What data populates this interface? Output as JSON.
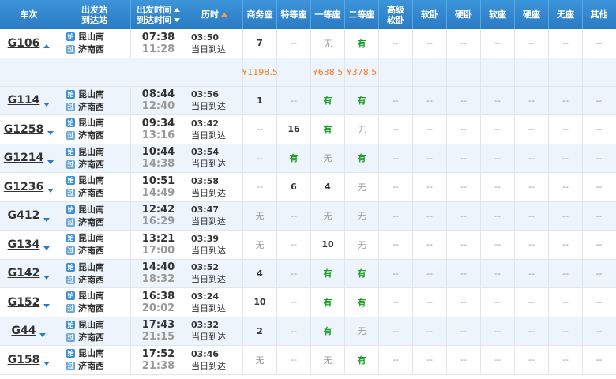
{
  "header": {
    "train": "车次",
    "from_station": "出发站",
    "to_station": "到达站",
    "dep_time": "出发时间",
    "arr_time": "到达时间",
    "duration": "历时",
    "seats": [
      {
        "top": "商务座"
      },
      {
        "top": "特等座"
      },
      {
        "top": "一等座"
      },
      {
        "top": "二等座"
      },
      {
        "top": "高级",
        "bottom": "软卧"
      },
      {
        "top": "软卧"
      },
      {
        "top": "硬卧"
      },
      {
        "top": "软座"
      },
      {
        "top": "硬座"
      },
      {
        "top": "无座"
      },
      {
        "top": "其他"
      }
    ]
  },
  "rows": [
    {
      "train": "G106",
      "expanded": true,
      "from": "昆山南",
      "to": "济南西",
      "dep": "07:38",
      "arr": "11:28",
      "dur": "03:50",
      "note": "当日到达",
      "seats": [
        "7",
        "--",
        "无",
        "有",
        "--",
        "--",
        "--",
        "--",
        "--",
        "--",
        "--"
      ],
      "prices": [
        "¥1198.5",
        "",
        "¥638.5",
        "¥378.5",
        "",
        "",
        "",
        "",
        "",
        "",
        ""
      ]
    },
    {
      "train": "G114",
      "from": "昆山南",
      "to": "济南西",
      "dep": "08:44",
      "arr": "12:40",
      "dur": "03:56",
      "note": "当日到达",
      "seats": [
        "1",
        "--",
        "有",
        "有",
        "--",
        "--",
        "--",
        "--",
        "--",
        "--",
        "--"
      ]
    },
    {
      "train": "G1258",
      "from": "昆山南",
      "to": "济南西",
      "dep": "09:34",
      "arr": "13:16",
      "dur": "03:42",
      "note": "当日到达",
      "seats": [
        "--",
        "16",
        "有",
        "无",
        "--",
        "--",
        "--",
        "--",
        "--",
        "--",
        "--"
      ]
    },
    {
      "train": "G1214",
      "from": "昆山南",
      "to": "济南西",
      "dep": "10:44",
      "arr": "14:38",
      "dur": "03:54",
      "note": "当日到达",
      "seats": [
        "--",
        "有",
        "无",
        "有",
        "--",
        "--",
        "--",
        "--",
        "--",
        "--",
        "--"
      ]
    },
    {
      "train": "G1236",
      "from": "昆山南",
      "to": "济南西",
      "dep": "10:51",
      "arr": "14:49",
      "dur": "03:58",
      "note": "当日到达",
      "seats": [
        "--",
        "6",
        "4",
        "无",
        "--",
        "--",
        "--",
        "--",
        "--",
        "--",
        "--"
      ]
    },
    {
      "train": "G412",
      "from": "昆山南",
      "to": "济南西",
      "dep": "12:42",
      "arr": "16:29",
      "dur": "03:47",
      "note": "当日到达",
      "seats": [
        "无",
        "--",
        "无",
        "无",
        "--",
        "--",
        "--",
        "--",
        "--",
        "--",
        "--"
      ]
    },
    {
      "train": "G134",
      "from": "昆山南",
      "to": "济南西",
      "dep": "13:21",
      "arr": "17:00",
      "dur": "03:39",
      "note": "当日到达",
      "seats": [
        "无",
        "--",
        "10",
        "无",
        "--",
        "--",
        "--",
        "--",
        "--",
        "--",
        "--"
      ]
    },
    {
      "train": "G142",
      "from": "昆山南",
      "to": "济南西",
      "dep": "14:40",
      "arr": "18:32",
      "dur": "03:52",
      "note": "当日到达",
      "seats": [
        "4",
        "--",
        "有",
        "有",
        "--",
        "--",
        "--",
        "--",
        "--",
        "--",
        "--"
      ]
    },
    {
      "train": "G152",
      "from": "昆山南",
      "to": "济南西",
      "dep": "16:38",
      "arr": "20:02",
      "dur": "03:24",
      "note": "当日到达",
      "seats": [
        "10",
        "--",
        "有",
        "有",
        "--",
        "--",
        "--",
        "--",
        "--",
        "--",
        "--"
      ]
    },
    {
      "train": "G44",
      "from": "昆山南",
      "to": "济南西",
      "dep": "17:43",
      "arr": "21:15",
      "dur": "03:32",
      "note": "当日到达",
      "seats": [
        "2",
        "--",
        "有",
        "无",
        "--",
        "--",
        "--",
        "--",
        "--",
        "--",
        "--"
      ]
    },
    {
      "train": "G158",
      "from": "昆山南",
      "to": "济南西",
      "dep": "17:52",
      "arr": "21:38",
      "dur": "03:46",
      "note": "当日到达",
      "seats": [
        "无",
        "--",
        "无",
        "有",
        "--",
        "--",
        "--",
        "--",
        "--",
        "--",
        "--"
      ]
    }
  ],
  "icons": {
    "start_icon": "始",
    "pass_icon": "过"
  },
  "colors": {
    "header_bg": "#2a7bc4",
    "available": "#1e9c2a",
    "price": "#f37d23",
    "row_alt": "#edf4fb"
  }
}
